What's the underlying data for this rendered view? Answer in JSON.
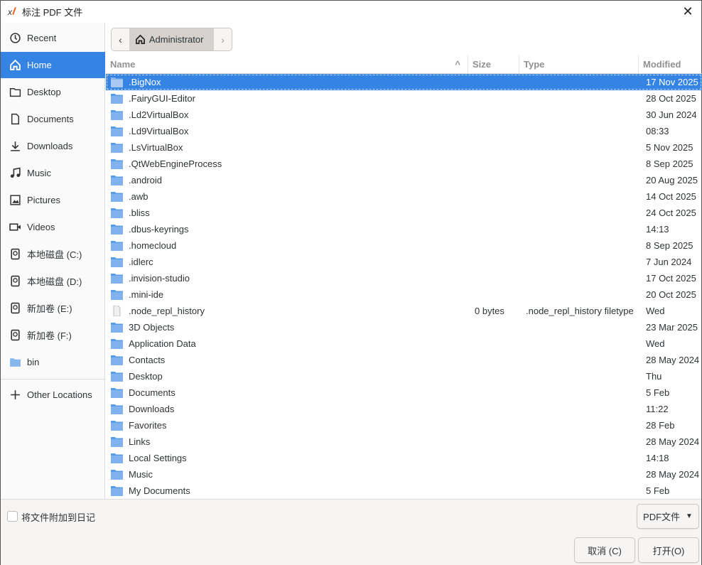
{
  "window": {
    "title": "标注 PDF 文件",
    "close": "✕"
  },
  "sidebar": {
    "items": [
      {
        "label": "Recent",
        "icon": "clock"
      },
      {
        "label": "Home",
        "icon": "home",
        "active": true
      },
      {
        "label": "Desktop",
        "icon": "folder"
      },
      {
        "label": "Documents",
        "icon": "document"
      },
      {
        "label": "Downloads",
        "icon": "download"
      },
      {
        "label": "Music",
        "icon": "music"
      },
      {
        "label": "Pictures",
        "icon": "picture"
      },
      {
        "label": "Videos",
        "icon": "video"
      },
      {
        "label": "本地磁盘 (C:)",
        "icon": "drive"
      },
      {
        "label": "本地磁盘 (D:)",
        "icon": "drive"
      },
      {
        "label": "新加卷 (E:)",
        "icon": "drive"
      },
      {
        "label": "新加卷 (F:)",
        "icon": "drive"
      },
      {
        "label": "bin",
        "icon": "folder-blue"
      }
    ],
    "other_locations": "Other Locations"
  },
  "pathbar": {
    "crumb": "Administrator"
  },
  "columns": {
    "name": "Name",
    "size": "Size",
    "type": "Type",
    "modified": "Modified"
  },
  "files": [
    {
      "name": ".BigNox",
      "size": "",
      "type": "",
      "modified": "17 Nov 2025",
      "kind": "folder"
    },
    {
      "name": ".FairyGUI-Editor",
      "size": "",
      "type": "",
      "modified": "28 Oct 2025",
      "kind": "folder"
    },
    {
      "name": ".Ld2VirtualBox",
      "size": "",
      "type": "",
      "modified": "30 Jun 2024",
      "kind": "folder"
    },
    {
      "name": ".Ld9VirtualBox",
      "size": "",
      "type": "",
      "modified": "08:33",
      "kind": "folder"
    },
    {
      "name": ".LsVirtualBox",
      "size": "",
      "type": "",
      "modified": "5 Nov 2025",
      "kind": "folder"
    },
    {
      "name": ".QtWebEngineProcess",
      "size": "",
      "type": "",
      "modified": "8 Sep 2025",
      "kind": "folder"
    },
    {
      "name": ".android",
      "size": "",
      "type": "",
      "modified": "20 Aug 2025",
      "kind": "folder"
    },
    {
      "name": ".awb",
      "size": "",
      "type": "",
      "modified": "14 Oct 2025",
      "kind": "folder"
    },
    {
      "name": ".bliss",
      "size": "",
      "type": "",
      "modified": "24 Oct 2025",
      "kind": "folder"
    },
    {
      "name": ".dbus-keyrings",
      "size": "",
      "type": "",
      "modified": "14:13",
      "kind": "folder"
    },
    {
      "name": ".homecloud",
      "size": "",
      "type": "",
      "modified": "8 Sep 2025",
      "kind": "folder"
    },
    {
      "name": ".idlerc",
      "size": "",
      "type": "",
      "modified": "7 Jun 2024",
      "kind": "folder"
    },
    {
      "name": ".invision-studio",
      "size": "",
      "type": "",
      "modified": "17 Oct 2025",
      "kind": "folder"
    },
    {
      "name": ".mini-ide",
      "size": "",
      "type": "",
      "modified": "20 Oct 2025",
      "kind": "folder"
    },
    {
      "name": ".node_repl_history",
      "size": "0 bytes",
      "type": ".node_repl_history filetype",
      "modified": "Wed",
      "kind": "file"
    },
    {
      "name": "3D Objects",
      "size": "",
      "type": "",
      "modified": "23 Mar 2025",
      "kind": "folder"
    },
    {
      "name": "Application Data",
      "size": "",
      "type": "",
      "modified": "Wed",
      "kind": "folder"
    },
    {
      "name": "Contacts",
      "size": "",
      "type": "",
      "modified": "28 May 2024",
      "kind": "folder"
    },
    {
      "name": "Desktop",
      "size": "",
      "type": "",
      "modified": "Thu",
      "kind": "folder"
    },
    {
      "name": "Documents",
      "size": "",
      "type": "",
      "modified": "5 Feb",
      "kind": "folder"
    },
    {
      "name": "Downloads",
      "size": "",
      "type": "",
      "modified": "11:22",
      "kind": "folder"
    },
    {
      "name": "Favorites",
      "size": "",
      "type": "",
      "modified": "28 Feb",
      "kind": "folder"
    },
    {
      "name": "Links",
      "size": "",
      "type": "",
      "modified": "28 May 2024",
      "kind": "folder"
    },
    {
      "name": "Local Settings",
      "size": "",
      "type": "",
      "modified": "14:18",
      "kind": "folder"
    },
    {
      "name": "Music",
      "size": "",
      "type": "",
      "modified": "28 May 2024",
      "kind": "folder"
    },
    {
      "name": "My Documents",
      "size": "",
      "type": "",
      "modified": "5 Feb",
      "kind": "folder"
    }
  ],
  "selected_index": 0,
  "footer": {
    "attach_label": "将文件附加到日记",
    "filter": "PDF文件",
    "cancel": "取消 (C)",
    "open": "打开(O)"
  },
  "colors": {
    "accent": "#3584e4",
    "folder": "#5a9de6"
  }
}
